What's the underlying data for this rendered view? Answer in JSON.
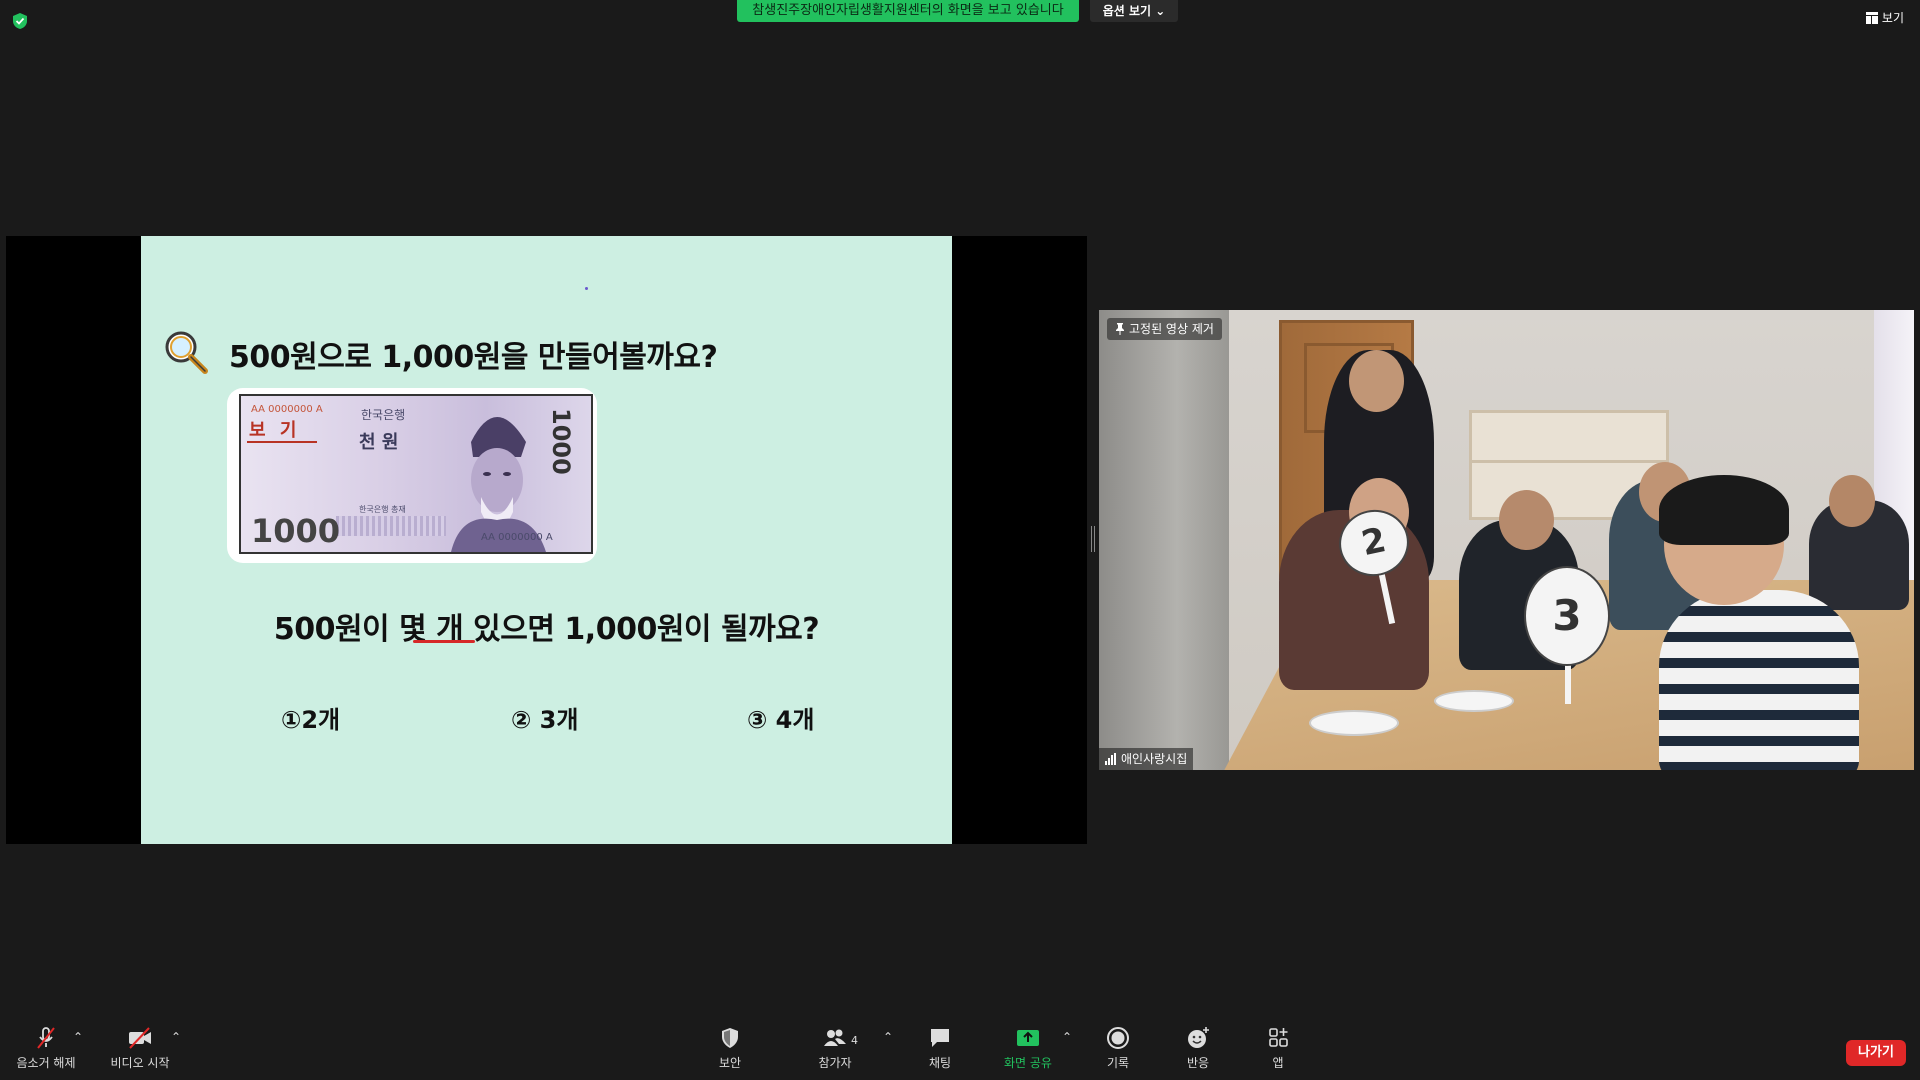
{
  "top": {
    "share_banner": "참생진주장애인자립생활지원센터의 화면을 보고 있습니다",
    "options_label": "옵션 보기 ⌄",
    "view_label": "보기"
  },
  "slide": {
    "title": "500원으로 1,000원을 만들어볼까요?",
    "question": "500원이 몇 개 있으면 1,000원이 될까요?",
    "options": [
      "①2개",
      "② 3개",
      "③ 4개"
    ],
    "bill": {
      "example_label": "보 기",
      "serial": "AA 0000000 A",
      "bank": "한국은행",
      "name": "천 원",
      "issuer": "한국은행 총재",
      "number": "1000"
    }
  },
  "video": {
    "pin_label": "고정된 영상 제거",
    "participant_name": "애인사랑시집",
    "paddles": [
      "2",
      "3"
    ]
  },
  "toolbar": {
    "mute": "음소거 해제",
    "video": "비디오 시작",
    "security": "보안",
    "participants": "참가자",
    "participants_count": "4",
    "chat": "채팅",
    "share": "화면 공유",
    "record": "기록",
    "reactions": "반응",
    "apps": "앱",
    "leave": "나가기"
  },
  "colors": {
    "share_green": "#22c15e",
    "leave_red": "#e02828",
    "slide_bg": "#cdefe2"
  }
}
